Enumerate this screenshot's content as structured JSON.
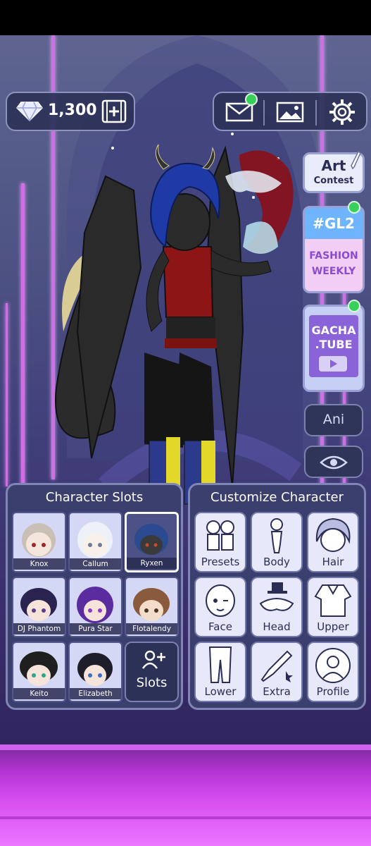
{
  "hud": {
    "diamonds": "1,300",
    "icons": [
      "diamond-icon",
      "film-add-icon",
      "mail-icon",
      "gallery-icon",
      "settings-gear-icon"
    ]
  },
  "side": {
    "art_contest": {
      "line1": "Art",
      "line2": "Contest"
    },
    "fashion_weekly": {
      "tag": "#GL2",
      "line1": "FASHION",
      "line2": "WEEKLY"
    },
    "gacha_tube": {
      "line1": "GACHA",
      "line2": ".TUBE"
    },
    "ani_label": "Ani"
  },
  "character_slots": {
    "title": "Character Slots",
    "slots": [
      {
        "name": "Knox"
      },
      {
        "name": "Callum"
      },
      {
        "name": "Ryxen",
        "selected": true
      },
      {
        "name": "DJ Phantom"
      },
      {
        "name": "Pura Star"
      },
      {
        "name": "Flotalendy"
      },
      {
        "name": "Keito"
      },
      {
        "name": "Elizabeth"
      }
    ],
    "add_label": "Slots"
  },
  "customize": {
    "title": "Customize Character",
    "buttons": [
      {
        "label": "Presets",
        "icon": "presets-icon"
      },
      {
        "label": "Body",
        "icon": "body-icon"
      },
      {
        "label": "Hair",
        "icon": "hair-icon"
      },
      {
        "label": "Face",
        "icon": "face-icon"
      },
      {
        "label": "Head",
        "icon": "head-icon"
      },
      {
        "label": "Upper",
        "icon": "upper-icon"
      },
      {
        "label": "Lower",
        "icon": "lower-icon"
      },
      {
        "label": "Extra",
        "icon": "extra-icon"
      },
      {
        "label": "Profile",
        "icon": "profile-icon"
      }
    ]
  },
  "colors": {
    "notification": "#37d15a",
    "accent": "#8d92be",
    "floor": "#d84ef0"
  }
}
